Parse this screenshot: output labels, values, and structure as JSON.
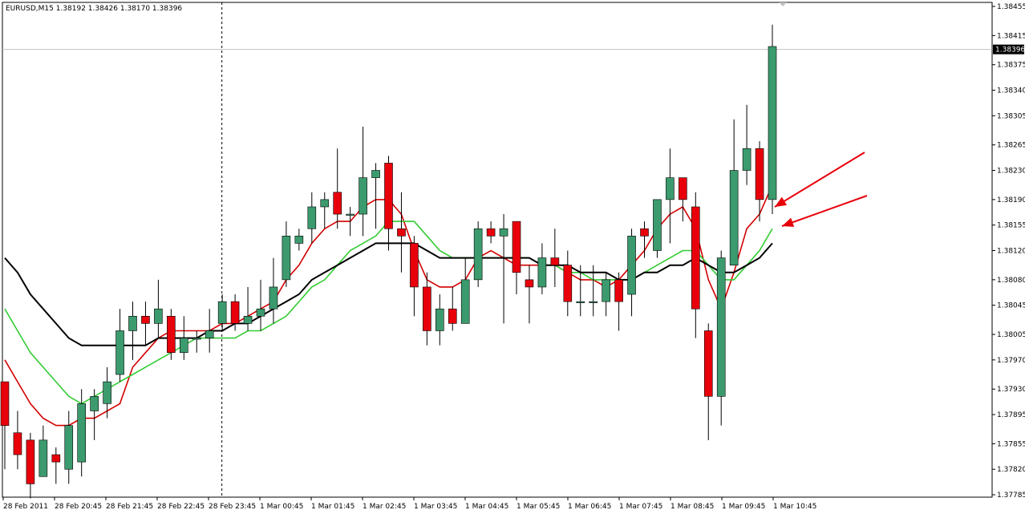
{
  "chart_data": {
    "type": "candlestick",
    "title": "EURUSD,M15  1.38192 1.38426 1.38170 1.38396",
    "symbol": "EURUSD",
    "timeframe": "M15",
    "ohlc_header": {
      "open": 1.38192,
      "high": 1.38426,
      "low": 1.3817,
      "close": 1.38396
    },
    "current_price_label": "1.38396",
    "ylim": [
      1.3775,
      1.3847
    ],
    "y_ticks": [
      "1.38455",
      "1.38415",
      "1.38375",
      "1.38340",
      "1.38305",
      "1.38265",
      "1.38230",
      "1.38190",
      "1.38155",
      "1.38120",
      "1.38080",
      "1.38045",
      "1.38005",
      "1.37970",
      "1.37930",
      "1.37895",
      "1.37855",
      "1.37820",
      "1.37785"
    ],
    "x_tick_labels": [
      "28 Feb 2011",
      "28 Feb 20:45",
      "28 Feb 21:45",
      "28 Feb 22:45",
      "28 Feb 23:45",
      "1 Mar 00:45",
      "1 Mar 01:45",
      "1 Mar 02:45",
      "1 Mar 03:45",
      "1 Mar 04:45",
      "1 Mar 05:45",
      "1 Mar 06:45",
      "1 Mar 07:45",
      "1 Mar 08:45",
      "1 Mar 09:45",
      "1 Mar 10:45"
    ],
    "bull_color": "#3c9b6e",
    "bear_color": "#e8000b",
    "candles": [
      [
        1.3794,
        1.3794,
        1.3782,
        1.3788
      ],
      [
        1.3787,
        1.379,
        1.3782,
        1.3784
      ],
      [
        1.3786,
        1.3787,
        1.3778,
        1.378
      ],
      [
        1.3781,
        1.3788,
        1.3781,
        1.3786
      ],
      [
        1.3784,
        1.3785,
        1.378,
        1.3783
      ],
      [
        1.3782,
        1.379,
        1.378,
        1.3788
      ],
      [
        1.3783,
        1.3793,
        1.3781,
        1.3791
      ],
      [
        1.379,
        1.3793,
        1.3786,
        1.3792
      ],
      [
        1.3791,
        1.3796,
        1.3789,
        1.3794
      ],
      [
        1.3795,
        1.3804,
        1.3794,
        1.3801
      ],
      [
        1.3801,
        1.3805,
        1.3797,
        1.3803
      ],
      [
        1.3803,
        1.3805,
        1.3799,
        1.3802
      ],
      [
        1.3802,
        1.3808,
        1.38,
        1.3804
      ],
      [
        1.3803,
        1.3804,
        1.3797,
        1.3798
      ],
      [
        1.3798,
        1.3803,
        1.3797,
        1.38
      ],
      [
        1.38,
        1.3801,
        1.3798,
        1.38
      ],
      [
        1.38,
        1.3804,
        1.3798,
        1.3801
      ],
      [
        1.3802,
        1.3806,
        1.3801,
        1.3805
      ],
      [
        1.3805,
        1.3806,
        1.3801,
        1.3802
      ],
      [
        1.3802,
        1.3807,
        1.3801,
        1.3803
      ],
      [
        1.3803,
        1.3808,
        1.3801,
        1.3804
      ],
      [
        1.3804,
        1.3811,
        1.3802,
        1.3807
      ],
      [
        1.3808,
        1.3816,
        1.3807,
        1.3814
      ],
      [
        1.3813,
        1.3815,
        1.3812,
        1.3814
      ],
      [
        1.3815,
        1.382,
        1.3813,
        1.3818
      ],
      [
        1.3818,
        1.382,
        1.3815,
        1.3819
      ],
      [
        1.382,
        1.3826,
        1.3815,
        1.3817
      ],
      [
        1.3817,
        1.3818,
        1.3814,
        1.3817
      ],
      [
        1.3817,
        1.3829,
        1.3814,
        1.3822
      ],
      [
        1.3822,
        1.3824,
        1.3815,
        1.3823
      ],
      [
        1.3824,
        1.3825,
        1.3812,
        1.3815
      ],
      [
        1.3815,
        1.382,
        1.3809,
        1.3814
      ],
      [
        1.3813,
        1.3814,
        1.3803,
        1.3807
      ],
      [
        1.3807,
        1.3809,
        1.3799,
        1.3801
      ],
      [
        1.3801,
        1.3806,
        1.3799,
        1.3804
      ],
      [
        1.3804,
        1.3807,
        1.3801,
        1.3802
      ],
      [
        1.3802,
        1.3811,
        1.3802,
        1.3808
      ],
      [
        1.3808,
        1.3816,
        1.3807,
        1.3815
      ],
      [
        1.3815,
        1.3816,
        1.3813,
        1.3814
      ],
      [
        1.3814,
        1.3817,
        1.3802,
        1.3815
      ],
      [
        1.3816,
        1.3816,
        1.3806,
        1.3809
      ],
      [
        1.3808,
        1.381,
        1.3802,
        1.3807
      ],
      [
        1.3807,
        1.3813,
        1.3806,
        1.3811
      ],
      [
        1.3811,
        1.3815,
        1.3807,
        1.381
      ],
      [
        1.381,
        1.3812,
        1.3803,
        1.3805
      ],
      [
        1.3805,
        1.381,
        1.3803,
        1.3805
      ],
      [
        1.3805,
        1.381,
        1.3803,
        1.3805
      ],
      [
        1.3805,
        1.3809,
        1.3803,
        1.3808
      ],
      [
        1.3808,
        1.3809,
        1.3801,
        1.3805
      ],
      [
        1.3806,
        1.3815,
        1.3803,
        1.3814
      ],
      [
        1.3815,
        1.3816,
        1.3811,
        1.3814
      ],
      [
        1.3812,
        1.3818,
        1.3811,
        1.3819
      ],
      [
        1.3819,
        1.3826,
        1.3813,
        1.3822
      ],
      [
        1.3822,
        1.3822,
        1.3816,
        1.3819
      ],
      [
        1.3818,
        1.382,
        1.38,
        1.3804
      ],
      [
        1.3801,
        1.3802,
        1.3786,
        1.3792
      ],
      [
        1.3792,
        1.3812,
        1.3788,
        1.3811
      ],
      [
        1.381,
        1.383,
        1.381,
        1.3823
      ],
      [
        1.3823,
        1.3832,
        1.3821,
        1.3826
      ],
      [
        1.3826,
        1.3827,
        1.3816,
        1.3819
      ],
      [
        1.3819,
        1.3843,
        1.3817,
        1.384
      ]
    ],
    "series": [
      {
        "color": "#d40000",
        "values": [
          1.3797,
          1.3794,
          1.3791,
          1.3789,
          1.3788,
          1.3788,
          1.3789,
          1.3789,
          1.379,
          1.3791,
          1.3796,
          1.3798,
          1.38,
          1.3801,
          1.3801,
          1.3801,
          1.3801,
          1.3802,
          1.3802,
          1.3803,
          1.3804,
          1.3805,
          1.3808,
          1.381,
          1.3813,
          1.3815,
          1.3816,
          1.3816,
          1.3818,
          1.3819,
          1.3819,
          1.3817,
          1.3812,
          1.3808,
          1.3807,
          1.3807,
          1.3808,
          1.3811,
          1.3812,
          1.3811,
          1.381,
          1.381,
          1.381,
          1.381,
          1.3809,
          1.3808,
          1.3808,
          1.3807,
          1.3808,
          1.381,
          1.3812,
          1.3815,
          1.3817,
          1.3818,
          1.3815,
          1.3808,
          1.3804,
          1.3809,
          1.3815,
          1.3817,
          1.3821
        ]
      },
      {
        "color": "#33cc33",
        "values": [
          1.3804,
          1.3801,
          1.3798,
          1.3796,
          1.3794,
          1.3792,
          1.3791,
          1.3792,
          1.3793,
          1.3794,
          1.3795,
          1.3796,
          1.3797,
          1.3798,
          1.3799,
          1.38,
          1.38,
          1.38,
          1.38,
          1.3801,
          1.3801,
          1.3802,
          1.3803,
          1.3805,
          1.3807,
          1.3808,
          1.381,
          1.3812,
          1.3813,
          1.3814,
          1.3816,
          1.3816,
          1.3816,
          1.3814,
          1.3812,
          1.3811,
          1.3811,
          1.3811,
          1.3811,
          1.3811,
          1.3811,
          1.3811,
          1.381,
          1.381,
          1.3809,
          1.3809,
          1.3808,
          1.3808,
          1.3808,
          1.3808,
          1.3809,
          1.381,
          1.3811,
          1.3812,
          1.3812,
          1.381,
          1.3808,
          1.3808,
          1.381,
          1.3812,
          1.3815
        ]
      },
      {
        "color": "#000000",
        "values": [
          1.3811,
          1.3809,
          1.3806,
          1.3804,
          1.3802,
          1.38,
          1.3799,
          1.3799,
          1.3799,
          1.3799,
          1.3799,
          1.3799,
          1.38,
          1.38,
          1.38,
          1.38,
          1.3801,
          1.3801,
          1.3802,
          1.3802,
          1.3803,
          1.3804,
          1.3805,
          1.3806,
          1.3808,
          1.3809,
          1.381,
          1.3811,
          1.3812,
          1.3813,
          1.3813,
          1.3813,
          1.3813,
          1.3812,
          1.3811,
          1.3811,
          1.3811,
          1.3811,
          1.3811,
          1.3811,
          1.3811,
          1.3811,
          1.381,
          1.381,
          1.381,
          1.3809,
          1.3809,
          1.3809,
          1.3808,
          1.3808,
          1.3809,
          1.3809,
          1.381,
          1.381,
          1.3811,
          1.381,
          1.3809,
          1.3809,
          1.381,
          1.3811,
          1.3813
        ]
      }
    ],
    "grid": false,
    "current_price_line": 1.38396,
    "period_separator_index": 17,
    "annotations": [
      {
        "type": "arrow",
        "color": "#e8000b",
        "points_to": "red moving average at latest bar"
      },
      {
        "type": "arrow",
        "color": "#e8000b",
        "points_to": "green moving average at latest bar"
      }
    ]
  }
}
